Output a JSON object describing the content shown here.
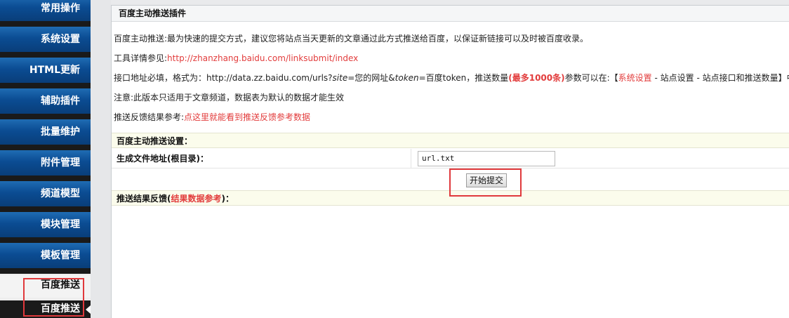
{
  "sidebar": {
    "items": [
      {
        "label": "常用操作"
      },
      {
        "label": "系统设置"
      },
      {
        "label": "HTML更新"
      },
      {
        "label": "辅助插件"
      },
      {
        "label": "批量维护"
      },
      {
        "label": "附件管理"
      },
      {
        "label": "频道模型"
      },
      {
        "label": "模块管理"
      },
      {
        "label": "模板管理"
      }
    ],
    "sub_heading": "百度推送",
    "active_item": "百度推送"
  },
  "panel": {
    "title": "百度主动推送插件",
    "intro": "百度主动推送:最为快速的提交方式，建议您将站点当天更新的文章通过此方式推送给百度，以保证新链接可以及时被百度收录。",
    "tool_prefix": "工具详情参见:",
    "tool_link": "http://zhanzhang.baidu.com/linksubmit/index",
    "api": {
      "p1": "接口地址必填，格式为：http://data.zz.baidu.com/urls?",
      "site": "site",
      "p2": "=您的网址&",
      "token": "token",
      "p3": "=百度token，推送数量",
      "max": "(最多1000条)",
      "p4": "参数可以在:【",
      "sys": "系统设置",
      "p5": " - 站点设置 - 站点接口和推送数量】中调"
    },
    "note": "注意:此版本只适用于文章频道，数据表为默认的数据才能生效",
    "feedback_prefix": "推送反馈结果参考:",
    "feedback_link": "点这里就能看到推送反馈参考数据",
    "settings_header": "百度主动推送设置：",
    "file_label": "生成文件地址(根目录)：",
    "file_value": "url.txt",
    "submit_label": "开始提交",
    "result_prefix": "推送结果反馈(",
    "result_link": "结果数据参考",
    "result_suffix": ")："
  },
  "colors": {
    "sidebar_blue": "#0b4c93",
    "accent_red": "#e23c3c",
    "highlight_box": "#e0393c"
  }
}
